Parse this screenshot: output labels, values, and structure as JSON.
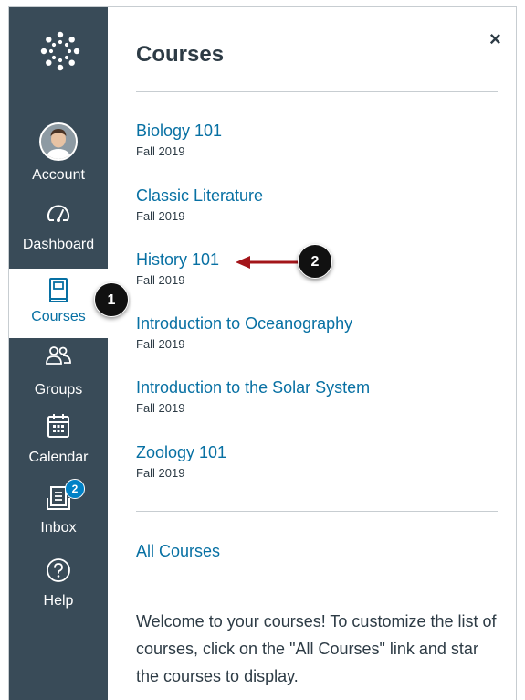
{
  "nav": {
    "account_label": "Account",
    "dashboard_label": "Dashboard",
    "courses_label": "Courses",
    "groups_label": "Groups",
    "calendar_label": "Calendar",
    "inbox_label": "Inbox",
    "inbox_badge": "2",
    "help_label": "Help",
    "background_color": "#394b58",
    "active_text_color": "#0770a3"
  },
  "tray": {
    "title": "Courses",
    "close_icon": "×",
    "courses": [
      {
        "name": "Biology 101",
        "term": "Fall 2019"
      },
      {
        "name": "Classic Literature",
        "term": "Fall 2019"
      },
      {
        "name": "History 101",
        "term": "Fall 2019"
      },
      {
        "name": "Introduction to Oceanography",
        "term": "Fall 2019"
      },
      {
        "name": "Introduction to the Solar System",
        "term": "Fall 2019"
      },
      {
        "name": "Zoology 101",
        "term": "Fall 2019"
      }
    ],
    "all_courses_label": "All Courses",
    "welcome_text": "Welcome to your courses! To customize the list of courses, click on the \"All Courses\" link and star the courses to display.",
    "link_color": "#0770a3"
  },
  "callouts": {
    "one": "1",
    "two": "2",
    "arrow_color": "#a3151a"
  }
}
